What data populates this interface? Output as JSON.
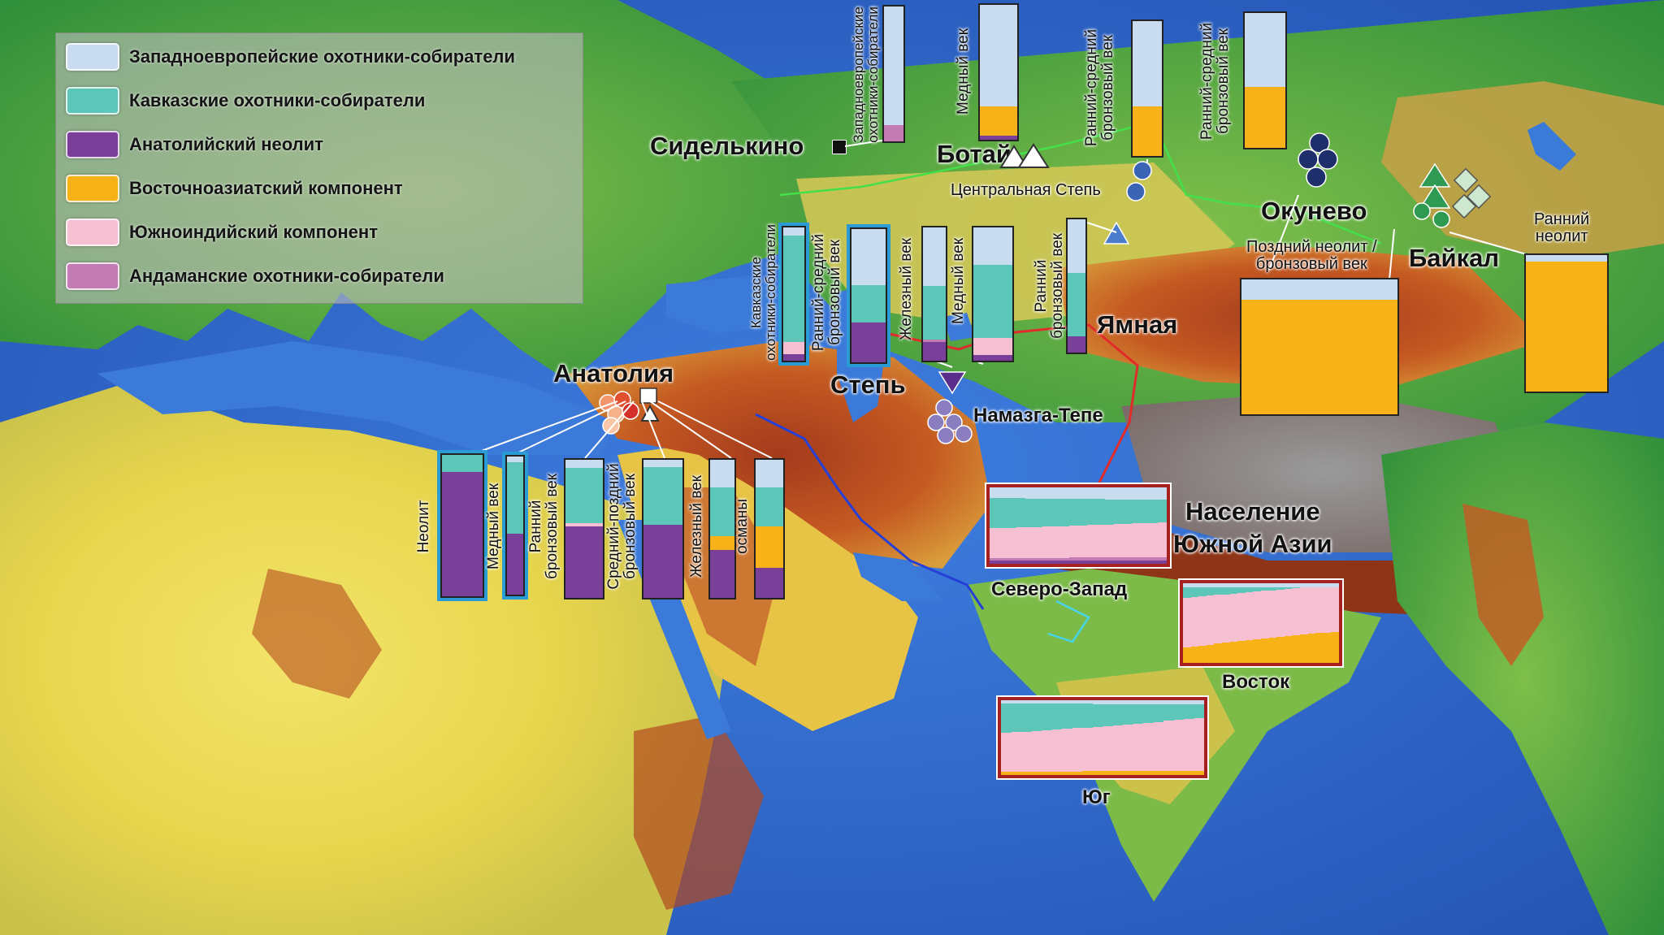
{
  "colors": {
    "whg": "#c9dcef",
    "chg": "#5cc7b8",
    "anatolian": "#7a3f98",
    "east_asian": "#f6b217",
    "south_indian": "#f7bfd2",
    "andaman": "#c37bb4"
  },
  "legend": [
    {
      "key": "whg",
      "label": "Западноевропейские охотники-собиратели"
    },
    {
      "key": "chg",
      "label": "Кавказские охотники-собиратели"
    },
    {
      "key": "anatolian",
      "label": "Анатолийский неолит"
    },
    {
      "key": "east_asian",
      "label": "Восточноазиатский компонент"
    },
    {
      "key": "south_indian",
      "label": "Южноиндийский компонент"
    },
    {
      "key": "andaman",
      "label": "Андаманские охотники-собиратели"
    }
  ],
  "places": {
    "sidelkino": "Сиделькино",
    "botai": "Ботай",
    "central_steppe": "Центральная Степь",
    "okunevo": "Окунево",
    "baikal": "Байкал",
    "anatolia": "Анатолия",
    "steppe": "Степь",
    "yamnaya": "Ямная",
    "namazga": "Намазга-Тепе",
    "south_asia": "Население\nЮжной Азии",
    "northwest": "Северо-Запад",
    "east": "Восток",
    "south": "Юг"
  },
  "bars": [
    {
      "id": "sidelkino-whg",
      "label": "Западноевропейские\nохотники-собиратели",
      "values": {
        "whg": 0.88,
        "andaman": 0.12
      }
    },
    {
      "id": "botai-copper",
      "label": "Медный век",
      "values": {
        "whg": 0.75,
        "east_asian": 0.22,
        "anatolian": 0.03
      }
    },
    {
      "id": "central-steppe-ebmba",
      "label": "Ранний-средний\nбронзовый век",
      "values": {
        "whg": 0.63,
        "east_asian": 0.37
      }
    },
    {
      "id": "okunevo-ebmba",
      "label": "Ранний-средний\nбронзовый век",
      "values": {
        "whg": 0.55,
        "east_asian": 0.45
      }
    },
    {
      "id": "steppe-chg",
      "label": "Кавказские\nохотники-собиратели",
      "values": {
        "chg": 0.8,
        "whg": 0.06,
        "south_indian": 0.09,
        "anatolian": 0.05
      }
    },
    {
      "id": "steppe-ebmba",
      "label": "Ранний-средний\nбронзовый век",
      "values": {
        "chg": 0.28,
        "whg": 0.42,
        "anatolian": 0.3
      }
    },
    {
      "id": "steppe-iron",
      "label": "Железный век",
      "values": {
        "chg": 0.4,
        "whg": 0.44,
        "andaman": 0.02,
        "anatolian": 0.14
      }
    },
    {
      "id": "steppe-copper",
      "label": "Медный век",
      "values": {
        "chg": 0.55,
        "whg": 0.28,
        "south_indian": 0.13,
        "anatolian": 0.04
      }
    },
    {
      "id": "yamnaya-ebma",
      "label": "Ранний\nбронзовый век",
      "values": {
        "chg": 0.48,
        "whg": 0.4,
        "anatolian": 0.12
      }
    },
    {
      "id": "anatolia-neolithic",
      "label": "Неолит",
      "values": {
        "chg": 0.12,
        "anatolian": 0.88
      }
    },
    {
      "id": "anatolia-copper",
      "label": "Медный век",
      "values": {
        "chg": 0.52,
        "whg": 0.04,
        "anatolian": 0.44
      }
    },
    {
      "id": "anatolia-eba",
      "label": "Ранний\nбронзовый век",
      "values": {
        "chg": 0.4,
        "whg": 0.06,
        "south_indian": 0.02,
        "anatolian": 0.52
      }
    },
    {
      "id": "anatolia-mlba",
      "label": "Средний-поздний\nбронзовый век",
      "values": {
        "chg": 0.42,
        "whg": 0.05,
        "anatolian": 0.53
      }
    },
    {
      "id": "anatolia-iron",
      "label": "Железный век",
      "values": {
        "chg": 0.35,
        "whg": 0.2,
        "east_asian": 0.1,
        "anatolian": 0.35
      }
    },
    {
      "id": "anatolia-ottoman",
      "label": "османы",
      "values": {
        "chg": 0.28,
        "whg": 0.2,
        "east_asian": 0.3,
        "anatolian": 0.22
      }
    },
    {
      "id": "okunevo-lnba",
      "label": "Поздний неолит /\nбронзовый век",
      "values": {
        "whg": 0.15,
        "east_asian": 0.85
      }
    },
    {
      "id": "baikal-en",
      "label": "Ранний\nнеолит",
      "values": {
        "whg": 0.05,
        "east_asian": 0.95
      }
    }
  ],
  "south_asia_panels": [
    {
      "id": "northwest",
      "values": {
        "chg": 0.35,
        "whg": 0.15,
        "south_indian": 0.42,
        "andaman": 0.04,
        "anatolian": 0.04
      }
    },
    {
      "id": "east",
      "values": {
        "chg": 0.05,
        "whg": 0.05,
        "south_indian": 0.6,
        "east_asian": 0.3
      }
    },
    {
      "id": "south",
      "values": {
        "chg": 0.3,
        "whg": 0.05,
        "south_indian": 0.6,
        "east_asian": 0.05
      }
    }
  ]
}
